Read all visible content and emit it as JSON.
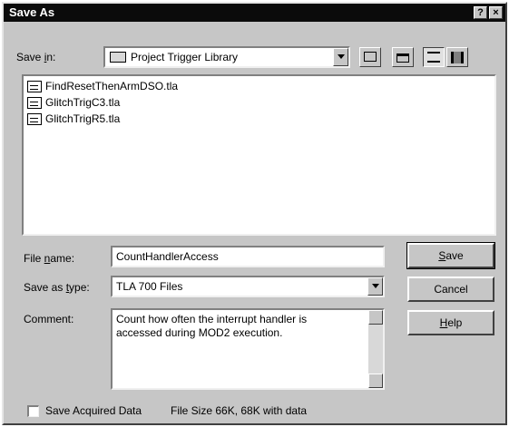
{
  "window": {
    "title": "Save As",
    "help_glyph": "?",
    "close_glyph": "×"
  },
  "save_in": {
    "label_prefix": "Save ",
    "label_underlined": "i",
    "label_suffix": "n:",
    "value": "Project Trigger Library"
  },
  "files": [
    {
      "name": "FindResetThenArmDSO.tla"
    },
    {
      "name": "GlitchTrigC3.tla"
    },
    {
      "name": "GlitchTrigR5.tla"
    }
  ],
  "file_name": {
    "label_prefix": "File ",
    "label_underlined": "n",
    "label_suffix": "ame:",
    "value": "CountHandlerAccess"
  },
  "save_as_type": {
    "label_prefix": "Save as ",
    "label_underlined": "t",
    "label_suffix": "ype:",
    "value": "TLA 700 Files"
  },
  "comment": {
    "label": "Comment:",
    "value": "Count how often the interrupt handler is accessed during MOD2 execution."
  },
  "buttons": {
    "save": {
      "underlined": "S",
      "rest": "ave"
    },
    "cancel": {
      "label": "Cancel"
    },
    "help": {
      "underlined": "H",
      "rest": "elp"
    }
  },
  "save_acquired": {
    "label": "Save Acquired Data",
    "checked": false
  },
  "file_size": {
    "text": "File Size  66K, 68K with data"
  }
}
